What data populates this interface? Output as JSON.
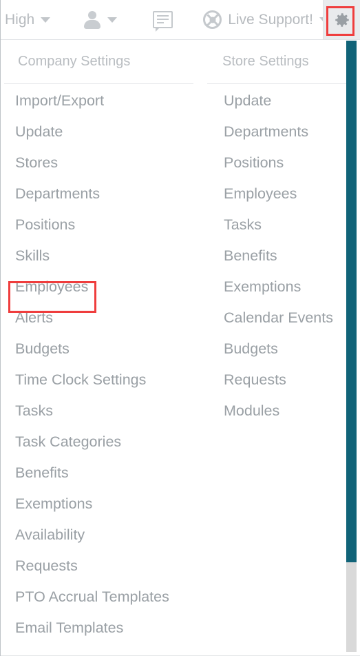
{
  "topbar": {
    "priority_selector": {
      "label": "High",
      "icon": "chevron-down-icon"
    },
    "user_menu": {
      "icon": "person-icon",
      "label": ""
    },
    "messages": {
      "icon": "chat-bubble-icon",
      "label": ""
    },
    "live_support": {
      "label": "Live Support!",
      "icon": "lifebuoy-icon"
    },
    "settings": {
      "icon": "gear-icon",
      "label": ""
    }
  },
  "highlights": {
    "color": "#ef3d3d",
    "targets": [
      "gear-icon",
      "company-settings-employees"
    ]
  },
  "columns": [
    {
      "id": "company-settings",
      "title": "Company Settings",
      "items": [
        "Import/Export",
        "Update",
        "Stores",
        "Departments",
        "Positions",
        "Skills",
        "Employees",
        "Alerts",
        "Budgets",
        "Time Clock Settings",
        "Tasks",
        "Task Categories",
        "Benefits",
        "Exemptions",
        "Availability",
        "Requests",
        "PTO Accrual Templates",
        "Email Templates"
      ],
      "selected_item": "Employees"
    },
    {
      "id": "store-settings",
      "title": "Store Settings",
      "items": [
        "Update",
        "Departments",
        "Positions",
        "Employees",
        "Tasks",
        "Benefits",
        "Exemptions",
        "Calendar Events",
        "Budgets",
        "Requests",
        "Modules"
      ],
      "selected_item": ""
    }
  ],
  "scrollbar": {
    "thumb_color": "#106378",
    "track_color": "#f0f0f0"
  }
}
